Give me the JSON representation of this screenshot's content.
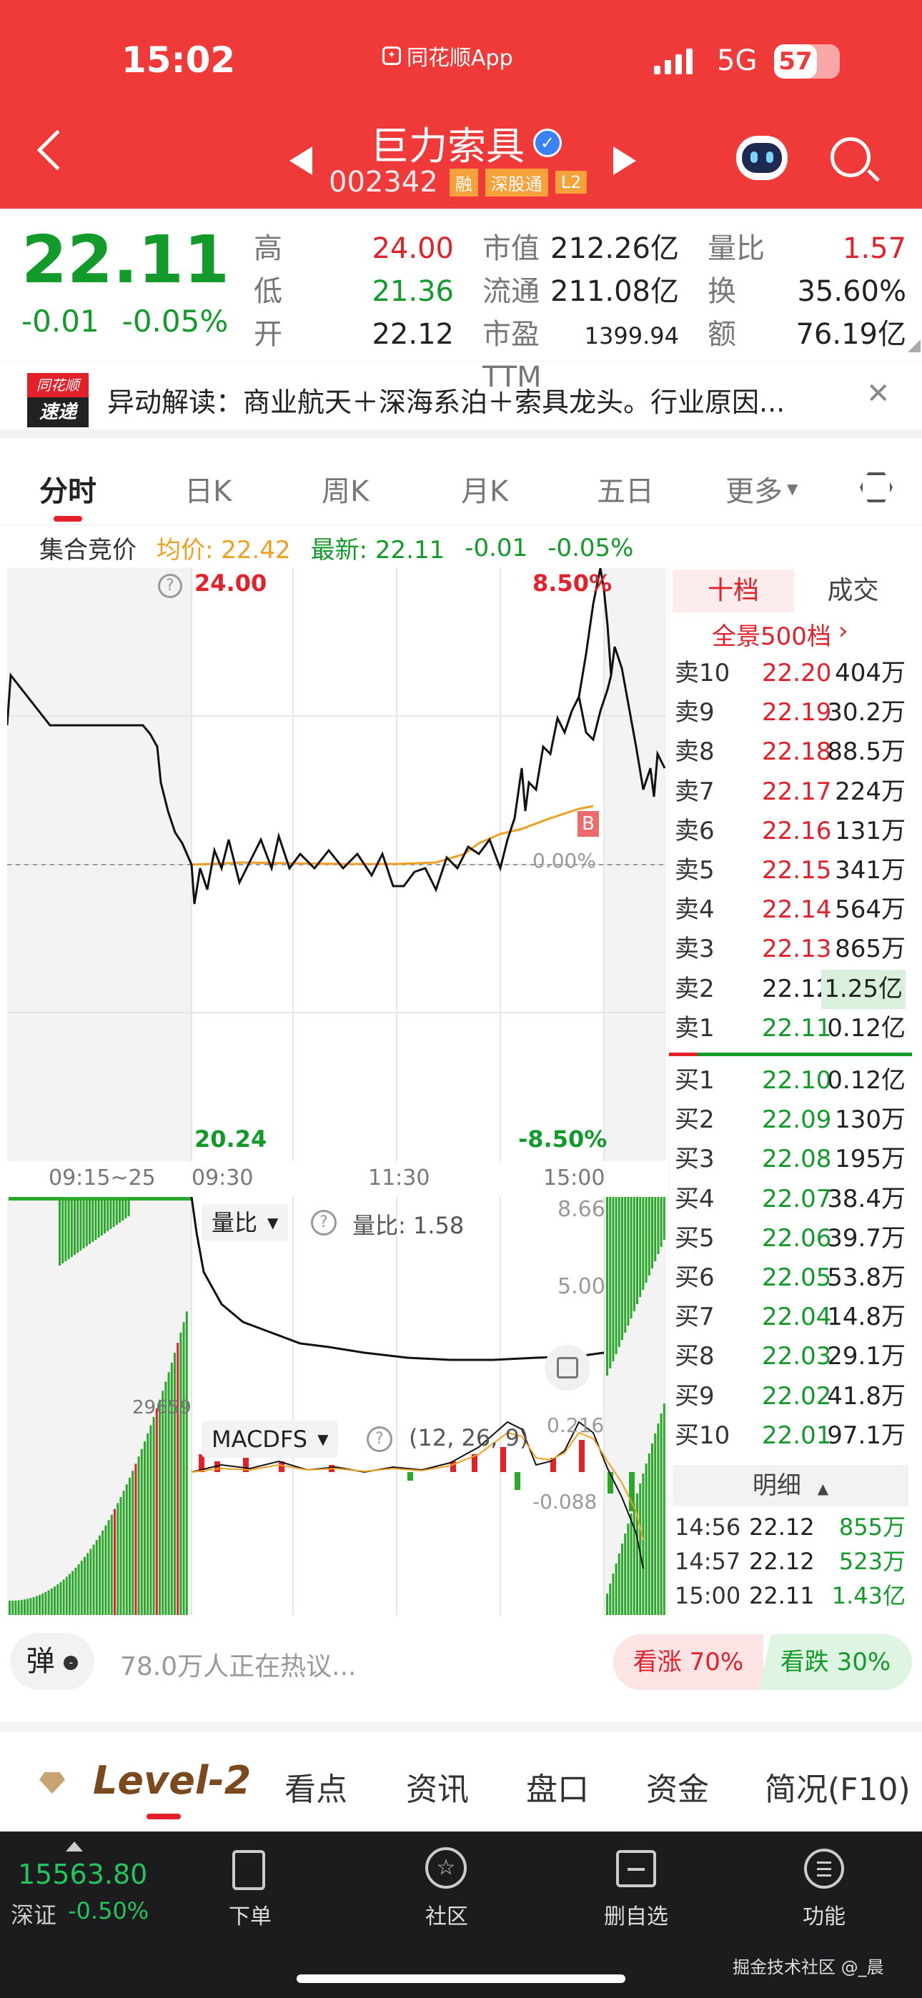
{
  "status_bar": {
    "time": "15:02",
    "app": "同花顺App",
    "network": "5G",
    "battery": "57"
  },
  "header": {
    "title": "巨力索具",
    "code": "002342",
    "badges": [
      "融",
      "深股通",
      "L2"
    ]
  },
  "quote": {
    "price": "22.11",
    "change": "-0.01",
    "change_pct": "-0.05%",
    "stats": [
      {
        "label": "高",
        "value": "24.00",
        "color": "red"
      },
      {
        "label": "低",
        "value": "21.36",
        "color": "green"
      },
      {
        "label": "开",
        "value": "22.12",
        "color": "black"
      }
    ],
    "stats2": [
      {
        "label": "市值",
        "value": "212.26亿"
      },
      {
        "label": "流通",
        "value": "211.08亿"
      },
      {
        "label": "市盈TTM",
        "value": "1399.94"
      }
    ],
    "stats3": [
      {
        "label": "量比",
        "value": "1.57",
        "color": "red"
      },
      {
        "label": "换",
        "value": "35.60%",
        "color": "black"
      },
      {
        "label": "额",
        "value": "76.19亿",
        "color": "black"
      }
    ]
  },
  "news": {
    "logo_top": "同花顺",
    "logo_bottom": "速递",
    "text": "异动解读：商业航天＋深海系泊＋索具龙头。行业原因..."
  },
  "chart_tabs": [
    "分时",
    "日K",
    "周K",
    "月K",
    "五日",
    "更多"
  ],
  "info_line": {
    "auction": "集合竞价",
    "avg": "均价: 22.42",
    "latest": "最新: 22.11",
    "chg": "-0.01",
    "pct": "-0.05%"
  },
  "chart_labels": {
    "top_left": "24.00",
    "top_right": "8.50%",
    "bottom_left": "20.24",
    "bottom_right": "-8.50%",
    "mid_right": "0.00%",
    "times": [
      "09:15~25",
      "09:30",
      "11:30",
      "15:00"
    ],
    "b_marker": "B",
    "vol_ratio_label": "量比",
    "vol_ratio_val": "量比: 1.58",
    "vol_ratio_top": "8.66",
    "vol_ratio_mid": "5.00",
    "vol_max": "29659",
    "macd_label": "MACDFS",
    "macd_params": "(12, 26, 9)",
    "macd_top": "0.216",
    "macd_bottom": "-0.088"
  },
  "orderbook": {
    "tabs": [
      "十档",
      "成交"
    ],
    "panorama": "全景500档",
    "sell": [
      {
        "label": "卖10",
        "price": "22.20",
        "vol": "404万"
      },
      {
        "label": "卖9",
        "price": "22.19",
        "vol": "30.2万"
      },
      {
        "label": "卖8",
        "price": "22.18",
        "vol": "88.5万"
      },
      {
        "label": "卖7",
        "price": "22.17",
        "vol": "224万"
      },
      {
        "label": "卖6",
        "price": "22.16",
        "vol": "131万"
      },
      {
        "label": "卖5",
        "price": "22.15",
        "vol": "341万"
      },
      {
        "label": "卖4",
        "price": "22.14",
        "vol": "564万"
      },
      {
        "label": "卖3",
        "price": "22.13",
        "vol": "865万"
      },
      {
        "label": "卖2",
        "price": "22.12",
        "vol": "1.25亿"
      },
      {
        "label": "卖1",
        "price": "22.11",
        "vol": "0.12亿"
      }
    ],
    "buy": [
      {
        "label": "买1",
        "price": "22.10",
        "vol": "0.12亿"
      },
      {
        "label": "买2",
        "price": "22.09",
        "vol": "130万"
      },
      {
        "label": "买3",
        "price": "22.08",
        "vol": "195万"
      },
      {
        "label": "买4",
        "price": "22.07",
        "vol": "38.4万"
      },
      {
        "label": "买5",
        "price": "22.06",
        "vol": "39.7万"
      },
      {
        "label": "买6",
        "price": "22.05",
        "vol": "53.8万"
      },
      {
        "label": "买7",
        "price": "22.04",
        "vol": "14.8万"
      },
      {
        "label": "买8",
        "price": "22.03",
        "vol": "29.1万"
      },
      {
        "label": "买9",
        "price": "22.02",
        "vol": "41.8万"
      },
      {
        "label": "买10",
        "price": "22.01",
        "vol": "97.1万"
      }
    ],
    "detail_label": "明细",
    "trades": [
      {
        "time": "14:56",
        "price": "22.12",
        "vol": "855万"
      },
      {
        "time": "14:57",
        "price": "22.12",
        "vol": "523万"
      },
      {
        "time": "15:00",
        "price": "22.11",
        "vol": "1.43亿"
      }
    ]
  },
  "discussion": {
    "danmu": "弹",
    "text": "78.0万人正在热议...",
    "bull": "看涨 70%",
    "bear": "看跌 30%"
  },
  "section_tabs": [
    "Level-2",
    "看点",
    "资讯",
    "盘口",
    "资金",
    "简况(F10)"
  ],
  "bottom_nav": {
    "index_value": "15563.80",
    "index_name": "深证",
    "index_chg": "-0.50%",
    "items": [
      "下单",
      "社区",
      "删自选",
      "功能"
    ],
    "watermark": "掘金技术社区 @_晨"
  }
}
